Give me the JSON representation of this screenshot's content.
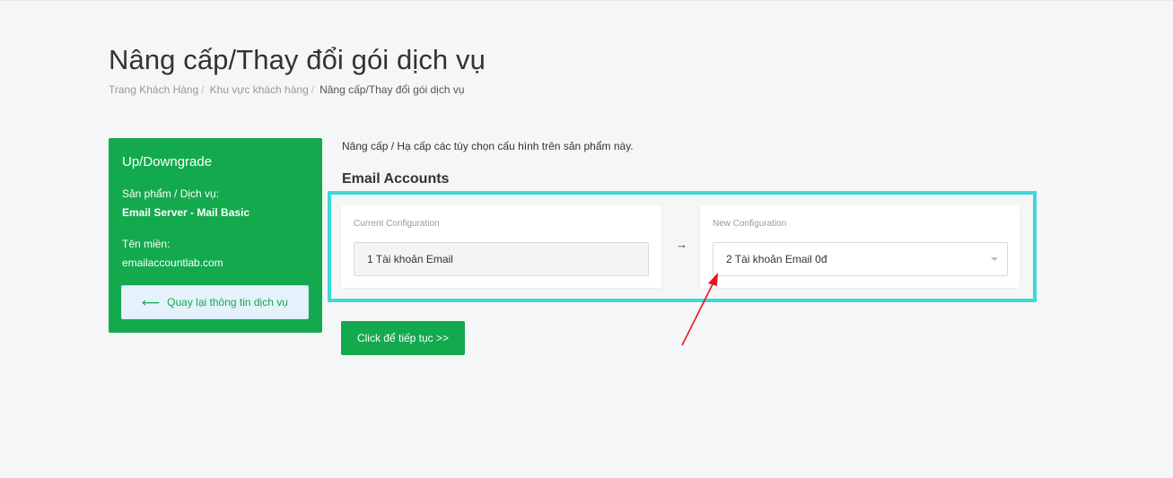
{
  "page": {
    "title": "Nâng cấp/Thay đổi gói dịch vụ",
    "breadcrumb": [
      "Trang Khách Hàng",
      "Khu vực khách hàng",
      "Nâng cấp/Thay đổi gói dịch vụ"
    ]
  },
  "sidebar": {
    "title": "Up/Downgrade",
    "product_label": "Sản phẩm / Dịch vụ:",
    "product_value": "Email Server - Mail Basic",
    "domain_label": "Tên miền:",
    "domain_value": "emailaccountlab.com",
    "back_button": "Quay lại thông tin dịch vụ",
    "back_icon": "arrow-left-icon"
  },
  "main": {
    "intro": "Nâng cấp / Hạ cấp các tùy chọn cấu hình trên sản phẩm này.",
    "section_title": "Email Accounts",
    "current": {
      "label": "Current Configuration",
      "value": "1 Tài khoản Email"
    },
    "arrow": "→",
    "new": {
      "label": "New Configuration",
      "selected": "2 Tài khoản Email 0đ"
    },
    "continue_button": "Click để tiếp tục >>"
  },
  "colors": {
    "brand_green": "#13a94d",
    "highlight_cyan": "#3ed8d8",
    "annotation_red": "#e8141b"
  }
}
